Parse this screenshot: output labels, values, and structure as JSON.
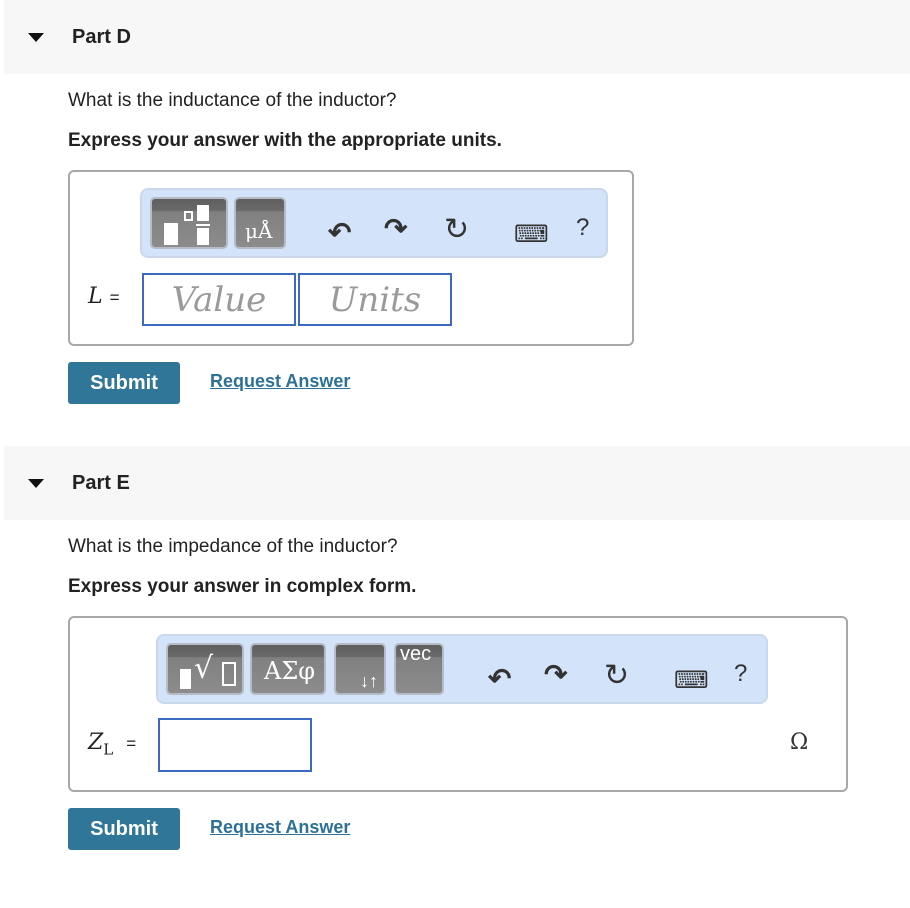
{
  "parts": [
    {
      "header": {
        "title": "Part D",
        "expanded": true
      },
      "question": "What is the inductance of the inductor?",
      "instruction": "Express your answer with the appropriate units.",
      "answer": {
        "variable": "L",
        "equals": "=",
        "value_placeholder": "Value",
        "units_placeholder": "Units",
        "value": "",
        "units": ""
      },
      "toolbar": {
        "buttons": [
          {
            "name": "templates-button",
            "icon": "fraction-templates-icon"
          },
          {
            "name": "units-button",
            "icon": "units-icon",
            "label": "μÅ"
          }
        ],
        "actions": [
          {
            "name": "undo-button",
            "icon": "undo-icon",
            "glyph": "↶"
          },
          {
            "name": "redo-button",
            "icon": "redo-icon",
            "glyph": "↷"
          },
          {
            "name": "reset-button",
            "icon": "reset-icon",
            "glyph": "↻"
          },
          {
            "name": "keyboard-button",
            "icon": "keyboard-icon",
            "glyph": "⌨"
          },
          {
            "name": "help-button",
            "icon": "help-icon",
            "glyph": "?"
          }
        ]
      },
      "submit_label": "Submit",
      "request_label": "Request Answer"
    },
    {
      "header": {
        "title": "Part E",
        "expanded": true
      },
      "question": "What is the impedance of the inductor?",
      "instruction": "Express your answer in complex form.",
      "answer": {
        "variable": "Z",
        "subscript": "L",
        "equals": "=",
        "value": "",
        "unit": "Ω"
      },
      "toolbar": {
        "buttons": [
          {
            "name": "templates-button",
            "icon": "root-templates-icon",
            "label": "ⁿ√□"
          },
          {
            "name": "greek-button",
            "icon": "greek-letters-icon",
            "label": "ΑΣφ"
          },
          {
            "name": "arrows-button",
            "icon": "arrows-icon",
            "label": "↓↑"
          },
          {
            "name": "vector-button",
            "icon": "vector-icon",
            "label": "vec"
          }
        ],
        "actions": [
          {
            "name": "undo-button",
            "icon": "undo-icon",
            "glyph": "↶"
          },
          {
            "name": "redo-button",
            "icon": "redo-icon",
            "glyph": "↷"
          },
          {
            "name": "reset-button",
            "icon": "reset-icon",
            "glyph": "↻"
          },
          {
            "name": "keyboard-button",
            "icon": "keyboard-icon",
            "glyph": "⌨"
          },
          {
            "name": "help-button",
            "icon": "help-icon",
            "glyph": "?"
          }
        ]
      },
      "submit_label": "Submit",
      "request_label": "Request Answer"
    }
  ],
  "colors": {
    "header_bg": "#f7f7f7",
    "toolbar_bg": "#d3e4fa",
    "input_border": "#3c6ac2",
    "submit_bg": "#2f7698",
    "link": "#2d7197"
  }
}
